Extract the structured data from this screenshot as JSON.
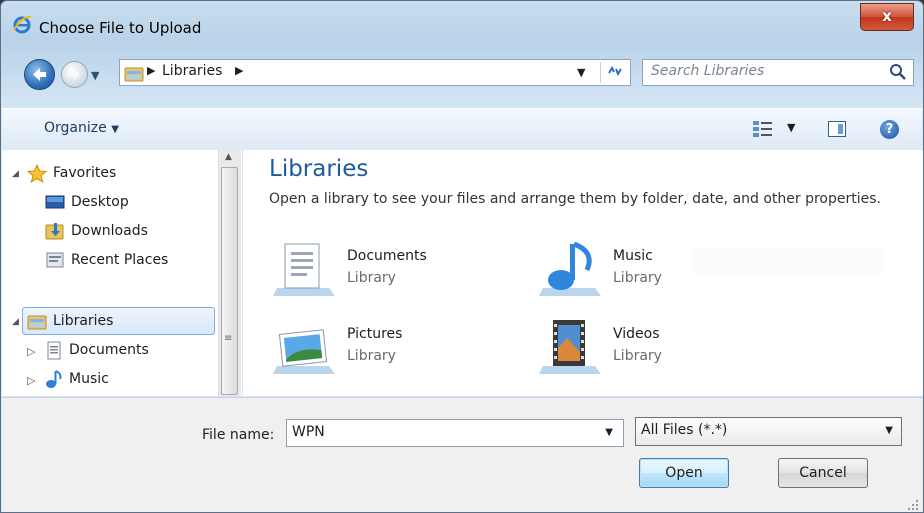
{
  "window": {
    "title": "Choose File to Upload",
    "close_label": "x"
  },
  "navbar": {
    "breadcrumb": "Libraries",
    "search_placeholder": "Search Libraries"
  },
  "commandbar": {
    "organize_label": "Organize"
  },
  "navpane": {
    "favorites": {
      "label": "Favorites",
      "items": [
        "Desktop",
        "Downloads",
        "Recent Places"
      ]
    },
    "libraries": {
      "label": "Libraries",
      "items": [
        "Documents",
        "Music"
      ]
    }
  },
  "content": {
    "heading": "Libraries",
    "description": "Open a library to see your files and arrange them by folder, date, and other properties.",
    "libraries": [
      {
        "name": "Documents",
        "type": "Library",
        "icon": "documents-library-icon"
      },
      {
        "name": "Music",
        "type": "Library",
        "icon": "music-library-icon"
      },
      {
        "name": "Pictures",
        "type": "Library",
        "icon": "pictures-library-icon"
      },
      {
        "name": "Videos",
        "type": "Library",
        "icon": "videos-library-icon"
      }
    ]
  },
  "footer": {
    "filename_label": "File name:",
    "filename_value": "WPN",
    "filter_value": "All Files (*.*)",
    "open_label": "Open",
    "cancel_label": "Cancel"
  }
}
